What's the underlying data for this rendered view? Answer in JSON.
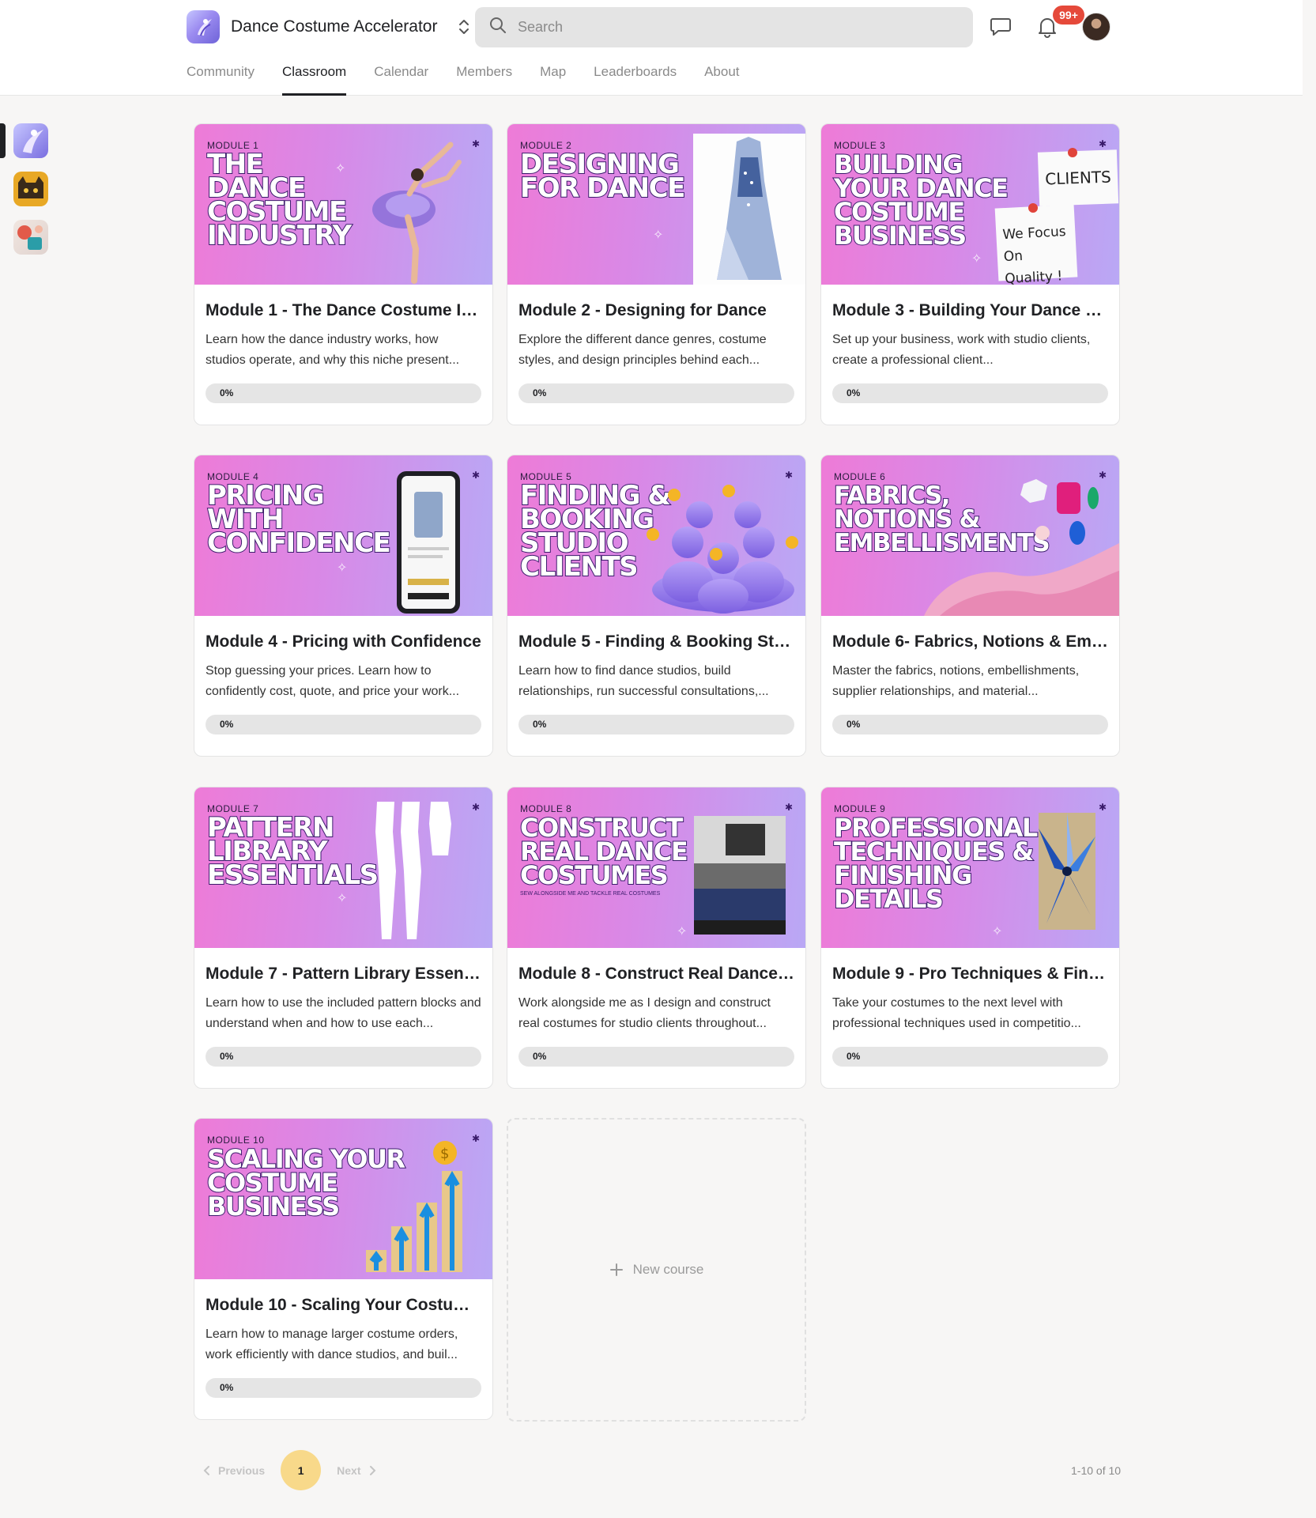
{
  "header": {
    "community_name": "Dance Costume Accelerator",
    "search_placeholder": "Search",
    "notification_badge": "99+",
    "icons": {
      "switcher": "chevron-up-down-icon",
      "search": "search-icon",
      "chat": "chat-icon",
      "bell": "bell-icon"
    }
  },
  "tabs": [
    {
      "label": "Community",
      "active": false
    },
    {
      "label": "Classroom",
      "active": true
    },
    {
      "label": "Calendar",
      "active": false
    },
    {
      "label": "Members",
      "active": false
    },
    {
      "label": "Map",
      "active": false
    },
    {
      "label": "Leaderboards",
      "active": false
    },
    {
      "label": "About",
      "active": false
    }
  ],
  "rail": [
    {
      "name": "dance-costume-accelerator",
      "active": true
    },
    {
      "name": "cat-community",
      "active": false
    },
    {
      "name": "art-community",
      "active": false
    }
  ],
  "courses": [
    {
      "module_label": "MODULE 1",
      "banner": [
        "THE",
        "DANCE",
        "COSTUME",
        "INDUSTRY"
      ],
      "title": "Module 1 - The Dance Costume In...",
      "description": "Learn how the dance industry works, how studios operate, and why this niche present...",
      "progress": "0%"
    },
    {
      "module_label": "MODULE 2",
      "banner": [
        "DESIGNING",
        "FOR DANCE"
      ],
      "title": "Module 2 - Designing for Dance",
      "description": "Explore the different dance genres, costume styles, and design principles behind each...",
      "progress": "0%"
    },
    {
      "module_label": "MODULE 3",
      "banner": [
        "BUILDING",
        "YOUR DANCE",
        "COSTUME",
        "BUSINESS"
      ],
      "note_top": "CLIENTS",
      "note_bottom_1": "We Focus",
      "note_bottom_2": "On Quality !",
      "title": "Module 3 - Building Your Dance C...",
      "description": "Set up your business, work with studio clients, create a professional client...",
      "progress": "0%"
    },
    {
      "module_label": "MODULE 4",
      "banner": [
        "PRICING",
        "WITH",
        "CONFIDENCE"
      ],
      "title": "Module 4 - Pricing with Confidence",
      "description": "Stop guessing your prices. Learn how to confidently cost, quote, and price your work...",
      "progress": "0%"
    },
    {
      "module_label": "MODULE 5",
      "banner": [
        "FINDING &",
        "BOOKING",
        "STUDIO",
        "CLIENTS"
      ],
      "title": "Module 5 - Finding & Booking Stu...",
      "description": "Learn how to find dance studios, build relationships, run successful consultations,...",
      "progress": "0%"
    },
    {
      "module_label": "MODULE 6",
      "banner": [
        "FABRICS,",
        "NOTIONS &",
        "EMBELLISMENTS"
      ],
      "title": "Module 6- Fabrics, Notions & Emb...",
      "description": "Master the fabrics, notions, embellishments, supplier relationships, and material...",
      "progress": "0%"
    },
    {
      "module_label": "MODULE 7",
      "banner": [
        "PATTERN",
        "LIBRARY",
        "ESSENTIALS"
      ],
      "title": "Module 7 - Pattern Library Essenti...",
      "description": "Learn how to use the included pattern blocks and understand when and how to use each...",
      "progress": "0%"
    },
    {
      "module_label": "MODULE 8",
      "banner": [
        "CONSTRUCT",
        "REAL DANCE",
        "COSTUMES"
      ],
      "banner_sub": "SEW ALONGSIDE ME AND TACKLE REAL COSTUMES",
      "title": "Module 8 - Construct Real Dance ...",
      "description": "Work alongside me as I design and construct real costumes for studio clients throughout...",
      "progress": "0%"
    },
    {
      "module_label": "MODULE 9",
      "banner": [
        "PROFESSIONAL",
        "TECHNIQUES &",
        "FINISHING",
        "DETAILS"
      ],
      "title": "Module 9 - Pro Techniques & Finis...",
      "description": "Take your costumes to the next level with professional techniques used in competitio...",
      "progress": "0%"
    },
    {
      "module_label": "MODULE 10",
      "banner": [
        "SCALING YOUR",
        "COSTUME",
        "BUSINESS"
      ],
      "title": "Module 10 - Scaling Your Costum...",
      "description": "Learn how to manage larger costume orders, work efficiently with dance studios, and buil...",
      "progress": "0%"
    }
  ],
  "new_course_label": "New course",
  "pagination": {
    "previous": "Previous",
    "current": "1",
    "next": "Next",
    "count": "1-10 of 10"
  },
  "colors": {
    "banner_pink": "#ee7bd7",
    "banner_lavender": "#b9a8f5",
    "badge_red": "#e5493a",
    "page_pill": "#f8d98a"
  }
}
